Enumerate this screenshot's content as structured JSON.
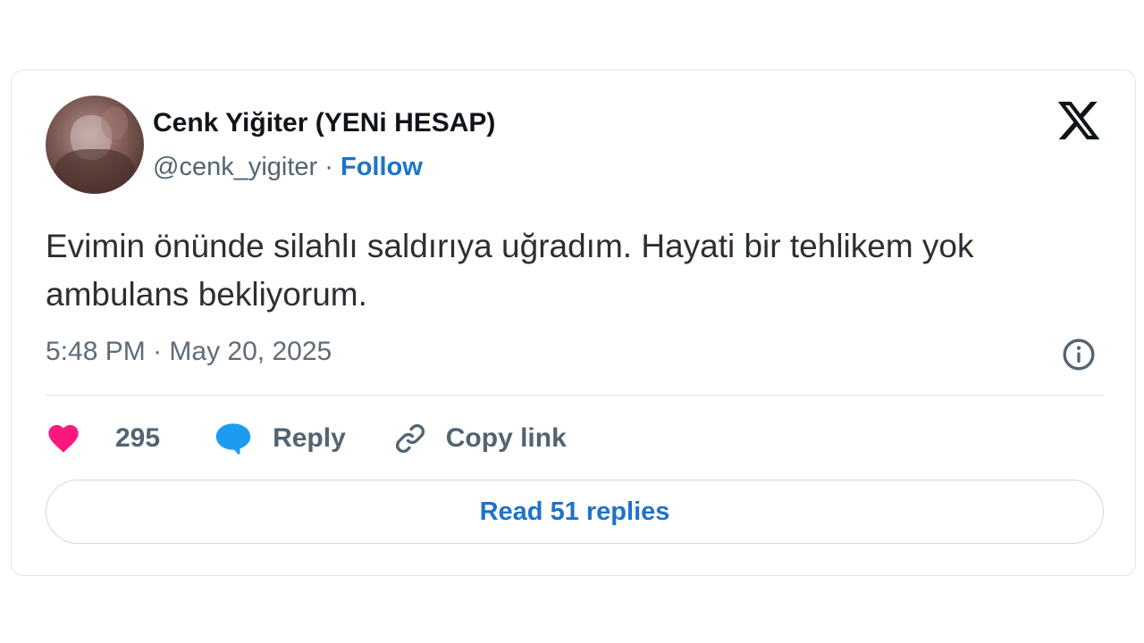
{
  "author": {
    "display_name": "Cenk Yiğiter (YENi HESAP)",
    "handle": "@cenk_yigiter",
    "separator": "·",
    "follow_label": "Follow"
  },
  "platform_icon": "x-logo-icon",
  "tweet": {
    "text": "Evimin önünde silahlı saldırıya uğradım. Hayati bir tehlikem yok ambulans bekliyorum.",
    "time": "5:48 PM",
    "date_separator": "·",
    "date": "May 20, 2025"
  },
  "actions": {
    "likes_count": "295",
    "reply_label": "Reply",
    "copy_link_label": "Copy link"
  },
  "read_replies_label": "Read 51 replies",
  "colors": {
    "like": "#f91880",
    "reply": "#1d9bf0",
    "link_text": "#1d73c9",
    "muted_text": "#536471",
    "border": "#dfe4e8"
  }
}
